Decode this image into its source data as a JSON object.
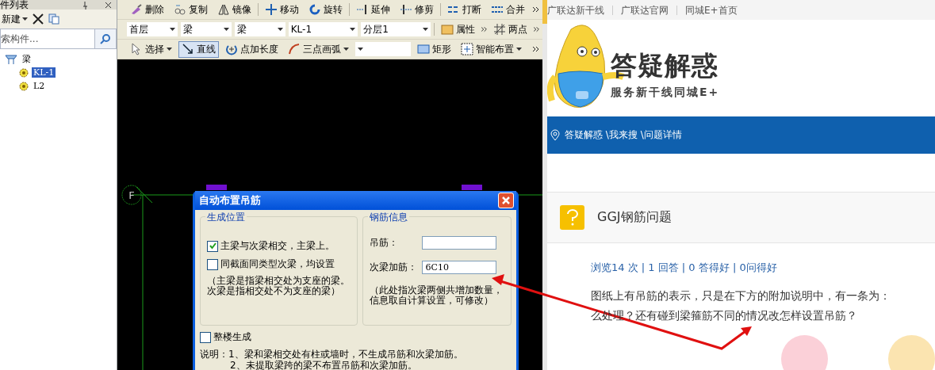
{
  "left_panel": {
    "title": "件列表",
    "new_label": "新建",
    "search": {
      "placeholder": "索构件..."
    },
    "tree": [
      {
        "label": "梁",
        "children": [
          {
            "label": "KL-1",
            "selected": true
          },
          {
            "label": "L2",
            "selected": false
          }
        ]
      }
    ]
  },
  "toolbar_1": [
    {
      "label": "删除"
    },
    {
      "label": "复制"
    },
    {
      "label": "镜像"
    },
    {
      "label": "移动"
    },
    {
      "label": "旋转"
    },
    {
      "label": "延伸"
    },
    {
      "label": "修剪"
    },
    {
      "label": "打断"
    },
    {
      "label": "合并"
    }
  ],
  "toolbar_2": {
    "combos": [
      "首层",
      "梁",
      "梁",
      "KL-1",
      "分层1"
    ],
    "buttons": [
      "属性",
      "两点"
    ]
  },
  "toolbar_3": [
    {
      "kind": "dropdown",
      "label": "选择",
      "selected": false
    },
    {
      "kind": "button",
      "label": "直线",
      "selected": true
    },
    {
      "kind": "button",
      "label": "点加长度",
      "selected": false
    },
    {
      "kind": "dropdown",
      "label": "三点画弧",
      "selected": false
    },
    {
      "kind": "combo"
    },
    {
      "kind": "button",
      "label": "矩形",
      "selected": false
    },
    {
      "kind": "dropdown",
      "label": "智能布置",
      "selected": false
    }
  ],
  "canvas": {
    "axis_label": "F"
  },
  "dialog": {
    "title": "自动布置吊筋",
    "position_group": {
      "title": "生成位置",
      "options": [
        {
          "label": "主梁与次梁相交，主梁上。",
          "checked": true
        },
        {
          "label": "同截面同类型次梁，均设置",
          "checked": false
        }
      ],
      "note": "（主梁是指梁相交处为支座的梁。次梁是指相交处不为支座的梁）"
    },
    "rebar_group": {
      "title": "钢筋信息",
      "fields": [
        {
          "label": "吊筋："
        },
        {
          "label": "次梁加筋：",
          "value": "6C10"
        }
      ],
      "note": "（此处指次梁两侧共增加数量，信息取自计算设置，可修改）"
    },
    "whole_building": {
      "label": "整楼生成",
      "checked": false
    },
    "notes": [
      "说明：1、梁和梁相交处有柱或墙时，不生成吊筋和次梁加筋。",
      "2、未提取梁跨的梁不布置吊筋和次梁加筋。"
    ]
  },
  "web": {
    "nav_links": [
      "广联达新干线",
      "广联达官网",
      "同城E+首页"
    ],
    "logo": {
      "title": "答疑解惑",
      "subtitle": "服务新干线同城E+"
    },
    "breadcrumb": "答疑解惑 \\我来搜 \\问题详情",
    "question": {
      "title": "GGJ钢筋问题",
      "stats": "浏览14 次 | 1 回答 | 0 答得好 | 0问得好",
      "body": [
        "图纸上有吊筋的表示，只是在下方的附加说明中，有一条为：",
        "么处理？还有碰到梁箍筋不同的情况改怎样设置吊筋？"
      ]
    }
  }
}
